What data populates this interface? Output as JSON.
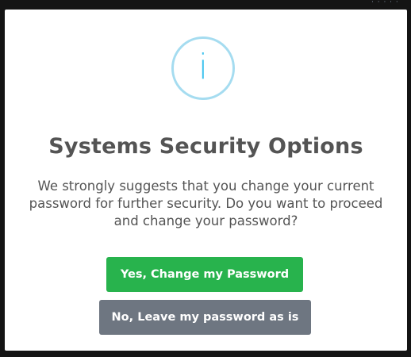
{
  "background": {
    "corner_text": "· · · · · ·"
  },
  "dialog": {
    "icon": {
      "name": "info-icon",
      "glyph": "i",
      "ring_color": "#a5dcf0",
      "glyph_color": "#3fc3ee"
    },
    "title": "Systems Security Options",
    "message": "We strongly suggests that you change your current password for further security. Do you want to proceed and change your password?",
    "confirm_label": "Yes, Change my Password",
    "cancel_label": "No, Leave my password as is",
    "colors": {
      "confirm": "#28b34d",
      "cancel": "#6e7681",
      "text": "#545454"
    }
  }
}
